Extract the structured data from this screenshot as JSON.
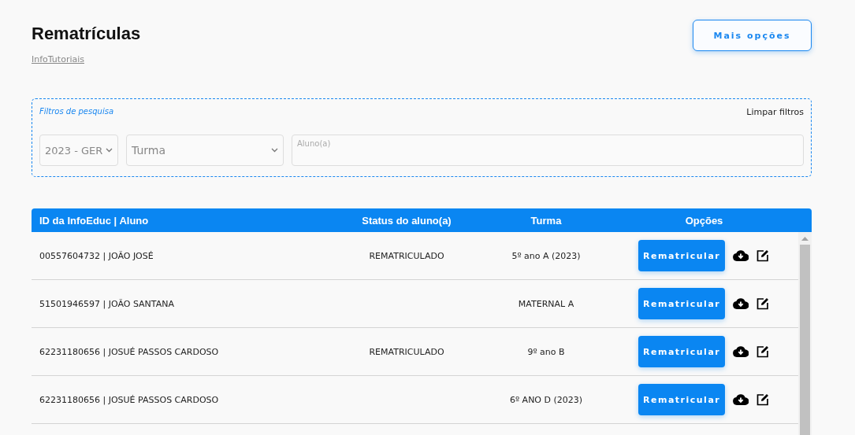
{
  "page": {
    "title": "Rematrículas",
    "breadcrumb_link": "InfoTutoriais",
    "more_button": "Mais opções"
  },
  "filters": {
    "title": "Filtros de pesquisa",
    "clear_link": "Limpar filtros",
    "year_select": "2023 - GER",
    "class_select": "Turma",
    "student_field": {
      "placeholder": "Aluno(a)"
    }
  },
  "table": {
    "columns": [
      "ID da InfoEduc | Aluno",
      "Status do aluno(a)",
      "Turma",
      "Opções"
    ],
    "rows": [
      {
        "student": "00557604732 | JOÃO  JOSÉ",
        "status": "REMATRICULADO",
        "class": "5º ano A (2023)",
        "action": "Rematricular"
      },
      {
        "student": "51501946597 | JOÃO  SANTANA",
        "status": "",
        "class": "MATERNAL A",
        "action": "Rematricular"
      },
      {
        "student": "62231180656 | JOSUÉ PASSOS CARDOSO",
        "status": "REMATRICULADO",
        "class": "9º ano B",
        "action": "Rematricular"
      },
      {
        "student": "62231180656 | JOSUÉ PASSOS CARDOSO",
        "status": "",
        "class": "6º ANO D (2023)",
        "action": "Rematricular"
      }
    ]
  }
}
